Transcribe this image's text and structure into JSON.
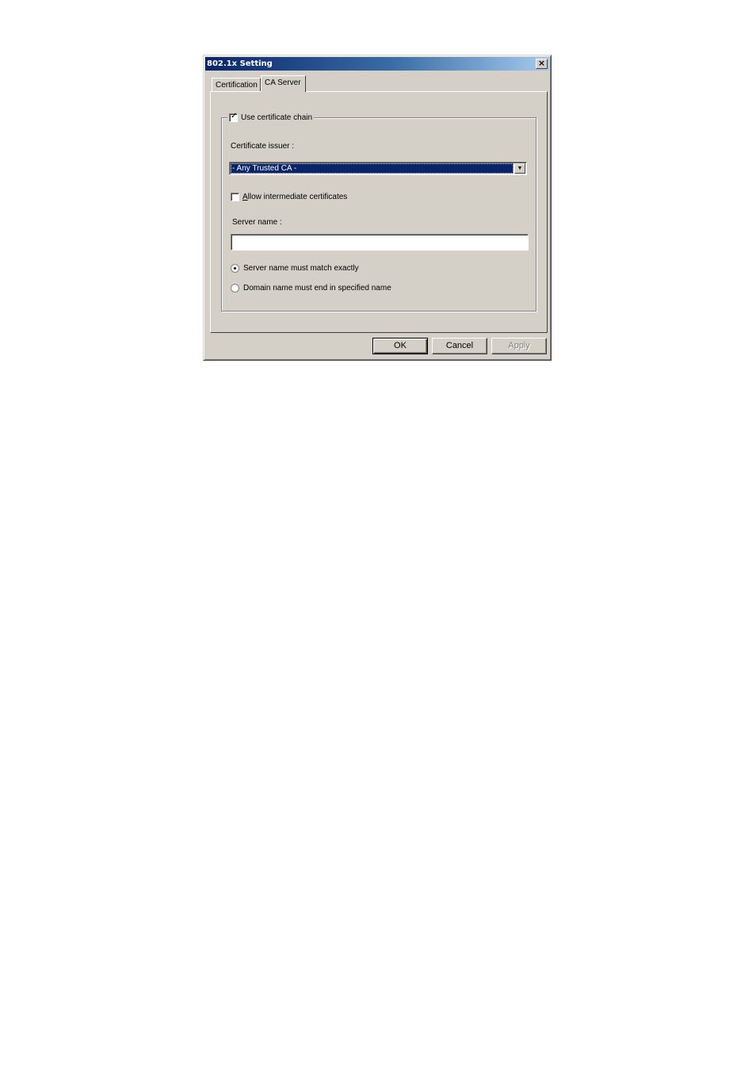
{
  "dialog": {
    "title": "802.1x Setting",
    "close_icon": "close-icon"
  },
  "tabs": [
    {
      "label": "Certification",
      "active": false
    },
    {
      "label": "CA Server",
      "active": true
    }
  ],
  "ca_server": {
    "use_chain": {
      "label": "Use certificate chain",
      "checked": true
    },
    "issuer_label": "Certificate issuer :",
    "issuer_selected": "- Any Trusted CA -",
    "allow_intermediate": {
      "label_first": "A",
      "label_rest": "llow intermediate certificates",
      "checked": false
    },
    "server_name_label": "Server name :",
    "server_name_value": "",
    "radio_exact": {
      "label": "Server name must match exactly",
      "checked": true
    },
    "radio_domain": {
      "label": "Domain name must end in specified name",
      "checked": false
    }
  },
  "buttons": {
    "ok": "OK",
    "cancel": "Cancel",
    "apply": "Apply"
  }
}
